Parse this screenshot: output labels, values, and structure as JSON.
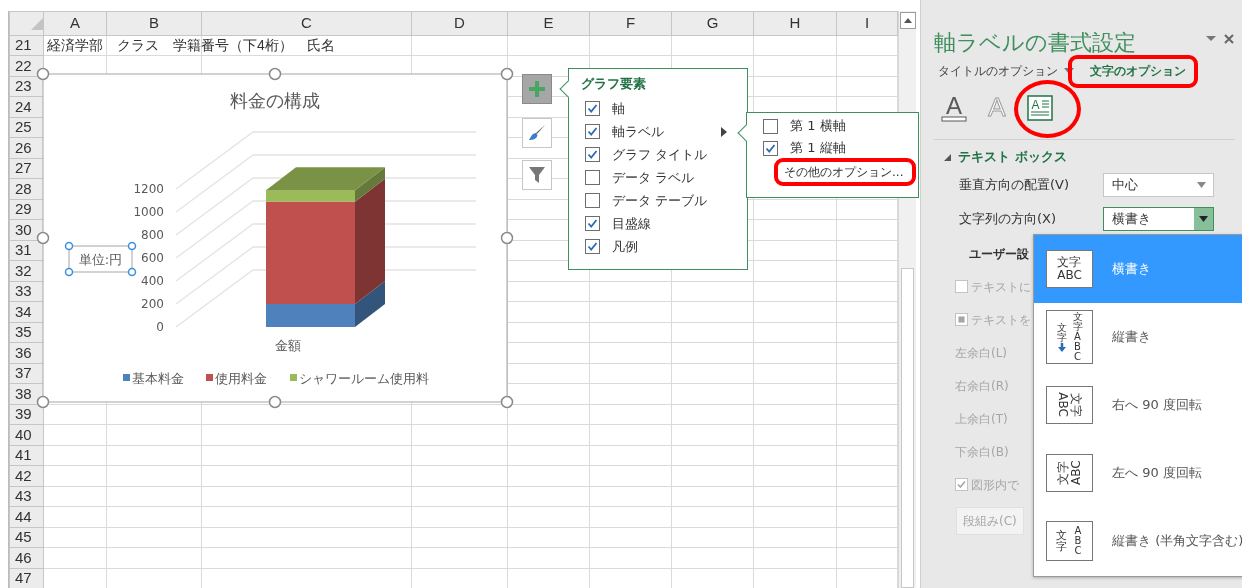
{
  "sheet": {
    "columns": [
      "A",
      "B",
      "C",
      "D",
      "E",
      "F",
      "G",
      "H",
      "I"
    ],
    "rows": [
      {
        "number": "21",
        "text": "経済学部　クラス　学籍番号（下4桁）　氏名"
      },
      {
        "number": "22"
      },
      {
        "number": "23"
      },
      {
        "number": "24"
      },
      {
        "number": "25"
      },
      {
        "number": "26"
      },
      {
        "number": "27"
      },
      {
        "number": "28"
      },
      {
        "number": "29"
      },
      {
        "number": "30"
      },
      {
        "number": "31"
      },
      {
        "number": "32"
      },
      {
        "number": "33"
      },
      {
        "number": "34"
      },
      {
        "number": "35"
      },
      {
        "number": "36"
      },
      {
        "number": "37"
      },
      {
        "number": "38"
      },
      {
        "number": "39"
      },
      {
        "number": "40"
      },
      {
        "number": "41"
      },
      {
        "number": "42"
      },
      {
        "number": "43"
      },
      {
        "number": "44"
      },
      {
        "number": "45"
      },
      {
        "number": "46"
      },
      {
        "number": "47"
      }
    ]
  },
  "chart": {
    "title": "料金の構成",
    "unit_label": "単位:円",
    "chart_data": {
      "type": "bar",
      "stacked": true,
      "legend": "bottom",
      "grid": true,
      "categories": [
        "金額"
      ],
      "ylim": [
        0,
        1200
      ],
      "yticks": [
        0,
        200,
        400,
        600,
        800,
        1000,
        1200
      ],
      "series": [
        {
          "name": "基本料金",
          "color": "#4f81bd",
          "values": [
            200
          ]
        },
        {
          "name": "使用料金",
          "color": "#c0504d",
          "values": [
            890
          ]
        },
        {
          "name": "シャワールーム使用料",
          "color": "#9bbb59",
          "values": [
            100
          ]
        }
      ]
    }
  },
  "chart_buttons": [
    {
      "kind": "elements",
      "selected": true
    },
    {
      "kind": "styles",
      "selected": false
    },
    {
      "kind": "filter",
      "selected": false
    }
  ],
  "chart_elements": {
    "title": "グラフ要素",
    "items": [
      {
        "label": "軸",
        "checked": true,
        "has_submenu": false
      },
      {
        "label": "軸ラベル",
        "checked": true,
        "has_submenu": true
      },
      {
        "label": "グラフ タイトル",
        "checked": true,
        "has_submenu": false
      },
      {
        "label": "データ ラベル",
        "checked": false,
        "has_submenu": false
      },
      {
        "label": "データ テーブル",
        "checked": false,
        "has_submenu": false
      },
      {
        "label": "目盛線",
        "checked": true,
        "has_submenu": false
      },
      {
        "label": "凡例",
        "checked": true,
        "has_submenu": false
      }
    ],
    "submenu": {
      "items": [
        {
          "label": "第 1 横軸",
          "checked": false
        },
        {
          "label": "第 1 縦軸",
          "checked": true
        }
      ],
      "more": "その他のオプション..."
    }
  },
  "format_pane": {
    "title": "軸ラベルの書式設定",
    "tabs": [
      {
        "label": "タイトルのオプション",
        "selected": false,
        "has_menu": true
      },
      {
        "label": "文字のオプション",
        "selected": true,
        "has_menu": false
      }
    ],
    "icon_tabs": [
      {
        "kind": "fill",
        "glyph": "A",
        "selected": false
      },
      {
        "kind": "outline",
        "glyph": "A",
        "selected": false
      },
      {
        "kind": "textbox",
        "glyph": "A",
        "selected": true
      }
    ],
    "section": {
      "title": "テキスト ボックス",
      "expanded": true
    },
    "fields": [
      {
        "label": "垂直方向の配置(V)",
        "value": "中心",
        "open": false
      },
      {
        "label": "文字列の方向(X)",
        "value": "横書き",
        "open": true
      }
    ],
    "rows": [
      {
        "kind": "heading",
        "label": "ユーザー設",
        "disabled": false
      },
      {
        "kind": "checkbox",
        "label": "テキストに",
        "checked": false,
        "indeterminate": false,
        "disabled": true
      },
      {
        "kind": "checkbox",
        "label": "テキストを",
        "checked": false,
        "indeterminate": true,
        "disabled": true
      },
      {
        "kind": "label",
        "label": "左余白(L)",
        "disabled": true
      },
      {
        "kind": "label",
        "label": "右余白(R)",
        "disabled": true
      },
      {
        "kind": "label",
        "label": "上余白(T)",
        "disabled": true
      },
      {
        "kind": "label",
        "label": "下余白(B)",
        "disabled": true
      },
      {
        "kind": "checkbox",
        "label": "図形内で",
        "checked": true,
        "indeterminate": false,
        "disabled": true
      },
      {
        "kind": "button",
        "label": "段組み(C)",
        "disabled": true
      }
    ],
    "direction_options": [
      {
        "label": "横書き",
        "kind": "horizontal",
        "icon_lines": [
          "文字",
          "ABC"
        ],
        "selected": true
      },
      {
        "label": "縦書き",
        "kind": "vertical",
        "icon_lines": [
          "文字",
          "文字ABC"
        ],
        "selected": false
      },
      {
        "label": "右へ 90 度回転",
        "kind": "rotate-right",
        "icon_lines": [
          "文字",
          "ABC"
        ],
        "selected": false
      },
      {
        "label": "左へ 90 度回転",
        "kind": "rotate-left",
        "icon_lines": [
          "文字",
          "ABC"
        ],
        "selected": false
      },
      {
        "label": "縦書き (半角文字含む)",
        "kind": "stacked",
        "icon_lines": [
          "文字",
          "ABC"
        ],
        "selected": false
      }
    ]
  }
}
